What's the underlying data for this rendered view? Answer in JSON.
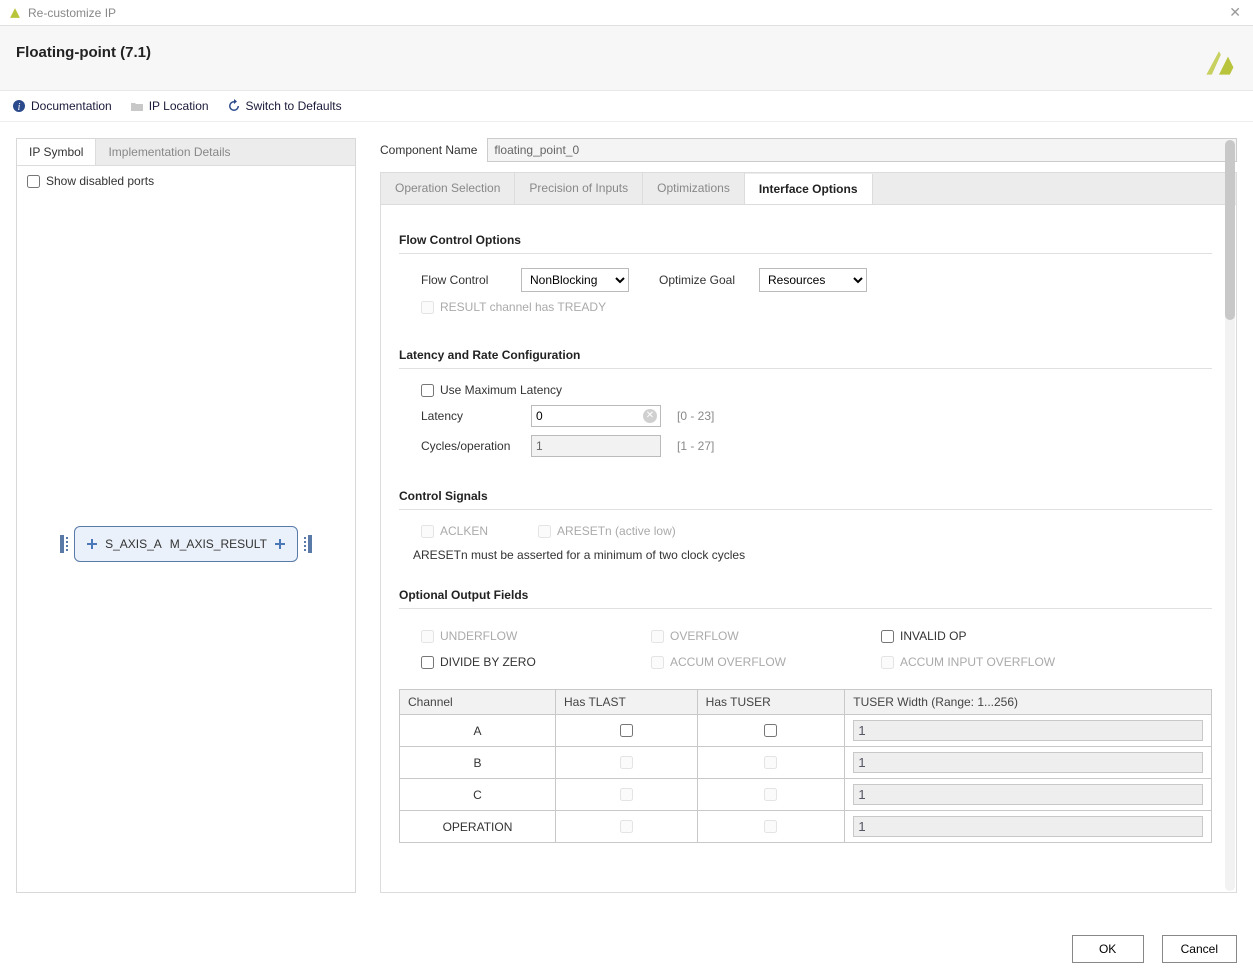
{
  "window": {
    "title": "Re-customize IP"
  },
  "header": {
    "title": "Floating-point (7.1)"
  },
  "toolbar": {
    "documentation": "Documentation",
    "ip_location": "IP Location",
    "switch_defaults": "Switch to Defaults"
  },
  "left": {
    "tabs": {
      "symbol": "IP Symbol",
      "impl": "Implementation Details"
    },
    "show_disabled": "Show disabled ports",
    "block": {
      "in_port": "S_AXIS_A",
      "out_port": "M_AXIS_RESULT"
    }
  },
  "compname": {
    "label": "Component Name",
    "value": "floating_point_0"
  },
  "tabs": {
    "op_sel": "Operation Selection",
    "precision": "Precision of Inputs",
    "optim": "Optimizations",
    "iface": "Interface Options"
  },
  "iface": {
    "flow_section": "Flow Control Options",
    "flow_control_label": "Flow Control",
    "flow_control_value": "NonBlocking",
    "optimize_goal_label": "Optimize Goal",
    "optimize_goal_value": "Resources",
    "result_tready": "RESULT channel has TREADY",
    "latency_section": "Latency and Rate Configuration",
    "use_max_latency": "Use Maximum Latency",
    "latency_label": "Latency",
    "latency_value": "0",
    "latency_range": "[0 - 23]",
    "cycles_label": "Cycles/operation",
    "cycles_value": "1",
    "cycles_range": "[1 - 27]",
    "ctrl_section": "Control Signals",
    "aclken": "ACLKEN",
    "aresetn": "ARESETn (active low)",
    "aresetn_note": "ARESETn must be asserted for a minimum of two clock cycles",
    "oof_section": "Optional Output Fields",
    "underflow": "UNDERFLOW",
    "overflow": "OVERFLOW",
    "invalid_op": "INVALID OP",
    "div_zero": "DIVIDE BY ZERO",
    "accum_ovf": "ACCUM OVERFLOW",
    "accum_in_ovf": "ACCUM INPUT OVERFLOW",
    "table": {
      "headers": {
        "channel": "Channel",
        "tlast": "Has TLAST",
        "tuser": "Has TUSER",
        "tuserw": "TUSER Width (Range: 1...256)"
      },
      "rows": [
        {
          "channel": "A",
          "tlast": false,
          "tlast_en": true,
          "tuser": false,
          "tuser_en": true,
          "tuserw": "1"
        },
        {
          "channel": "B",
          "tlast": false,
          "tlast_en": false,
          "tuser": false,
          "tuser_en": false,
          "tuserw": "1"
        },
        {
          "channel": "C",
          "tlast": false,
          "tlast_en": false,
          "tuser": false,
          "tuser_en": false,
          "tuserw": "1"
        },
        {
          "channel": "OPERATION",
          "tlast": false,
          "tlast_en": false,
          "tuser": false,
          "tuser_en": false,
          "tuserw": "1"
        }
      ]
    }
  },
  "footer": {
    "ok": "OK",
    "cancel": "Cancel"
  }
}
